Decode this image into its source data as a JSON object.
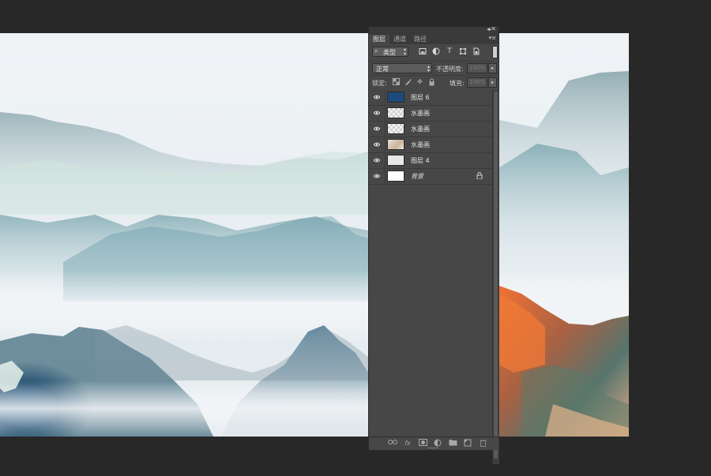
{
  "canvas": {
    "description_colors": {
      "sky": "#eef2f5",
      "mist": "#e2e9ec",
      "ridge": "#aac4cc",
      "dark_blue": "#1b3f72",
      "autumn": "#e0652a"
    }
  },
  "panel": {
    "tabs": [
      {
        "label": "图层",
        "active": true
      },
      {
        "label": "通道",
        "active": false
      },
      {
        "label": "路径",
        "active": false
      }
    ],
    "filter": {
      "kind_label": "类型"
    },
    "blend_mode": "正常",
    "opacity_label": "不透明度:",
    "opacity_value": "100%",
    "lock_label": "锁定:",
    "fill_label": "填充:",
    "fill_value": "100%",
    "layers": [
      {
        "name": "图层 6",
        "thumb": "solid",
        "visible": true,
        "locked": false
      },
      {
        "name": "水墨画",
        "thumb": "checker",
        "visible": true,
        "locked": false
      },
      {
        "name": "水墨画",
        "thumb": "checker",
        "visible": true,
        "locked": false
      },
      {
        "name": "水墨画",
        "thumb": "checker2",
        "visible": true,
        "locked": false
      },
      {
        "name": "图层 4",
        "thumb": "light",
        "visible": true,
        "locked": false
      },
      {
        "name": "背景",
        "thumb": "white",
        "visible": true,
        "locked": true
      }
    ],
    "icons": {
      "filter": [
        "image-filter-icon",
        "adjustment-filter-icon",
        "type-filter-icon",
        "shape-filter-icon",
        "smart-object-filter-icon"
      ],
      "lock": [
        "lock-transparent-pixels-icon",
        "lock-image-pixels-icon",
        "lock-position-icon",
        "lock-all-icon"
      ],
      "bottom": [
        "link-layers-icon",
        "fx-icon",
        "add-mask-icon",
        "new-adjustment-layer-icon",
        "new-group-icon",
        "new-layer-icon",
        "delete-layer-icon"
      ]
    }
  }
}
